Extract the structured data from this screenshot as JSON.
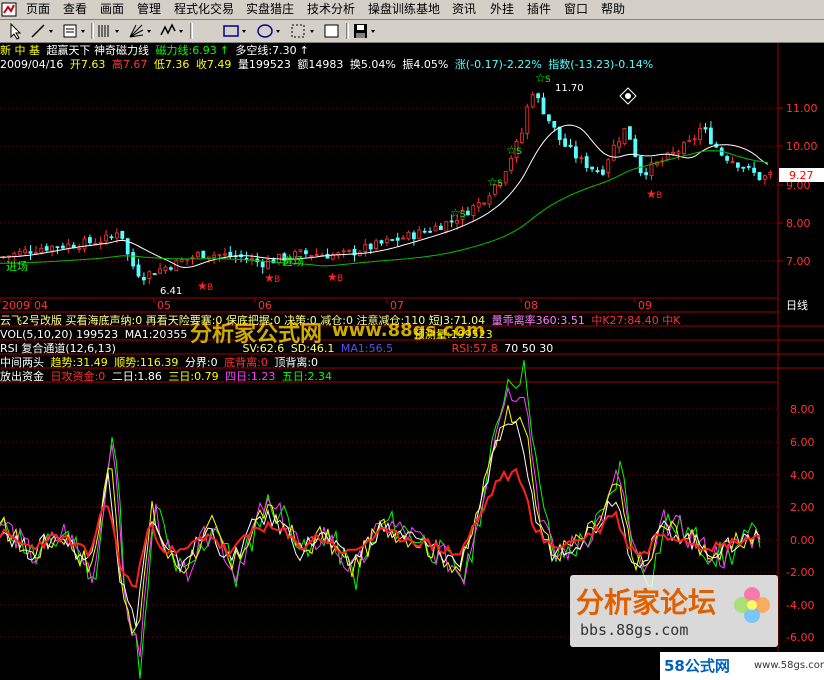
{
  "menu": {
    "items": [
      "页面",
      "查看",
      "画面",
      "管理",
      "程式化交易",
      "实盘猎庄",
      "技术分析",
      "操盘训练基地",
      "资讯",
      "外挂",
      "插件",
      "窗口",
      "帮助"
    ]
  },
  "toolbar": {
    "icons": [
      "cursor-icon",
      "line-tool-icon",
      "indicator-icon",
      "bars-icon",
      "fan-tool-icon",
      "wave-icon",
      "rectangle-icon",
      "ellipse-icon",
      "dotted-square-icon",
      "floppy-save-icon"
    ]
  },
  "header": {
    "stock_name": "新 中 基",
    "indicator_name": "超赢天下 神奇磁力线",
    "cili_line": "磁力线:6.93",
    "multi_line": "多空线:7.30",
    "date": "2009/04/16",
    "open": "开7.63",
    "high": "高7.67",
    "low": "低7.36",
    "close": "收7.49",
    "volume": "量199523",
    "amount": "额14983",
    "turnover": "换5.04%",
    "amplitude": "振4.05%",
    "change": "涨(-0.17)-2.22%",
    "index": "指数(-13.23)-0.14%"
  },
  "price_axis": {
    "ticks": [
      "11.00",
      "10.00",
      "9.00",
      "8.00",
      "7.00"
    ],
    "current": "9.27"
  },
  "price_labels": {
    "high": "11.70",
    "low": "6.41"
  },
  "signals": {
    "buy": "B",
    "sell": "S",
    "entry": "进场"
  },
  "date_axis": {
    "labels": [
      "2009",
      "04",
      "05",
      "06",
      "07",
      "08",
      "09"
    ],
    "period": "日线"
  },
  "ind1": {
    "text": "云飞2号改版  买看海底声纳:0  再看天险要塞:0  保底把握:0  决策:0  减仓:0  注意减仓:110  短J3:71.04",
    "text2": "量乖离率360:3.51",
    "text3": "中K27:84.40  中K"
  },
  "ind2": {
    "t1": "VOL(5,10,20) 199523",
    "t2": "MA1:20355",
    "t3": "预测量:199523"
  },
  "ind3": {
    "t1": "RSI 复合通道(12,6,13)",
    "t2": "SV:62.6",
    "t3": "SD:46.1",
    "t4": "MA1:56.5",
    "t5": "RSI:57.8",
    "t6": "70 50 30"
  },
  "ind4": {
    "t1": "中间两头",
    "t2": "趋势:31.49",
    "t3": "顺势:116.39",
    "t4": "分界:0",
    "t5": "底背离:0",
    "t6": "顶背离:0"
  },
  "ind5": {
    "t1": "放出资金",
    "t2": "日攻资金:0",
    "t3": "二日:1.86",
    "t4": "三日:0.79",
    "t5": "四日:1.23",
    "t6": "五日:2.34"
  },
  "lower_axis": {
    "ticks": [
      "8.00",
      "6.00",
      "4.00",
      "2.00",
      "0.00",
      "-2.00",
      "-4.00",
      "-6.00"
    ]
  },
  "watermarks": {
    "w1": "分析家公式网",
    "w2": "www.88gs.com",
    "forum": "分析家论坛",
    "forum_url": "bbs.88gs.com",
    "site": "58公式网",
    "site_url": "www.58gs.com"
  },
  "colors": {
    "up": "#ff3232",
    "down": "#54ffff",
    "ma": "#ffffff",
    "ma2": "#00c000",
    "bg": "#000000",
    "grid": "#a00000"
  }
}
